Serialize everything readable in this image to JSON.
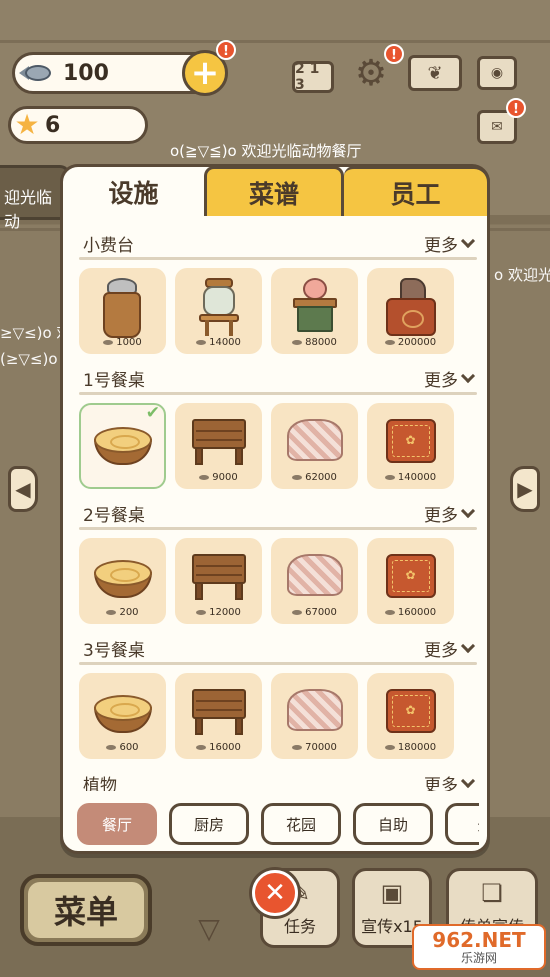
{
  "hud": {
    "fish_count": "100",
    "star_count": "6",
    "plus_label": "+",
    "alert_mark": "!",
    "ranking_label": "2 1 3"
  },
  "welcome_text": "o(≧▽≦)o 欢迎光临动物餐厅",
  "tickers": {
    "left_sign": "迎光临动",
    "left_face_1": "≥▽≤)o 欢",
    "left_face_2": "(≥▽≤)o",
    "right_ticker": "o 欢迎光"
  },
  "panel": {
    "tabs": [
      {
        "label": "设施",
        "active": true
      },
      {
        "label": "菜谱",
        "active": false
      },
      {
        "label": "员工",
        "active": false
      }
    ],
    "more_label": "更多",
    "sections": [
      {
        "title": "小费台",
        "items": [
          {
            "price": "1000"
          },
          {
            "price": "14000"
          },
          {
            "price": "88000"
          },
          {
            "price": "200000"
          }
        ]
      },
      {
        "title": "1号餐桌",
        "items": [
          {
            "price": "",
            "selected": true
          },
          {
            "price": "9000"
          },
          {
            "price": "62000"
          },
          {
            "price": "140000"
          }
        ]
      },
      {
        "title": "2号餐桌",
        "items": [
          {
            "price": "200"
          },
          {
            "price": "12000"
          },
          {
            "price": "67000"
          },
          {
            "price": "160000"
          }
        ]
      },
      {
        "title": "3号餐桌",
        "items": [
          {
            "price": "600"
          },
          {
            "price": "16000"
          },
          {
            "price": "70000"
          },
          {
            "price": "180000"
          }
        ]
      },
      {
        "title": "植物",
        "items": []
      }
    ],
    "categories": [
      {
        "label": "餐厅",
        "active": true
      },
      {
        "label": "厨房",
        "active": false
      },
      {
        "label": "花园",
        "active": false
      },
      {
        "label": "自助",
        "active": false
      },
      {
        "label": "外",
        "active": false
      }
    ]
  },
  "bottom": {
    "menu_label": "菜单",
    "task_label": "任务",
    "promo_label": "宣传x15",
    "flyer_label": "传单宣传",
    "close_label": "✕"
  },
  "watermark": {
    "main": "962.NET",
    "sub": "乐游网"
  },
  "colors": {
    "accent_yellow": "#f5c542",
    "outline_brown": "#5a4a38",
    "card_bg": "#f8e4c3",
    "active_chip": "#c48b78",
    "alert_red": "#e8552f",
    "selected_check": "#7cbd68"
  }
}
